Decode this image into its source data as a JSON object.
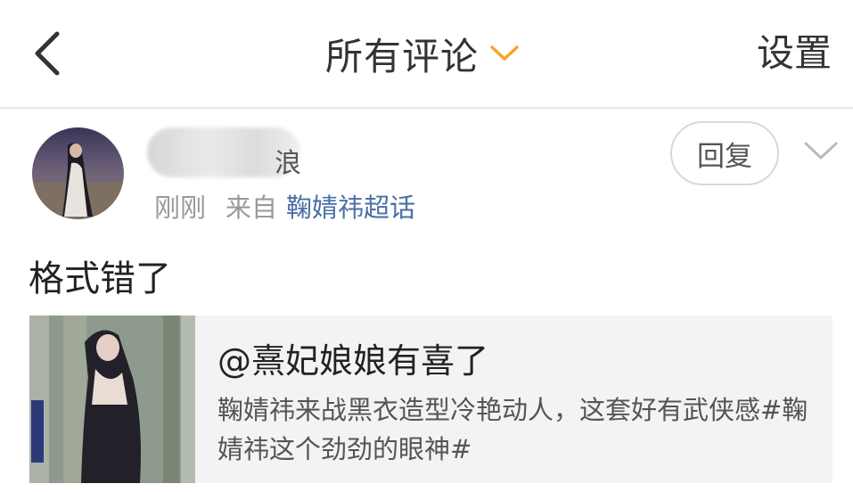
{
  "header": {
    "title": "所有评论",
    "settings_label": "设置",
    "back_icon": "chevron-left-icon",
    "title_arrow_icon": "chevron-down-icon",
    "accent_color": "#f5a623"
  },
  "comment": {
    "username_partial": "浪",
    "time": "刚刚",
    "from_label": "来自",
    "source": "鞠婧祎超话",
    "reply_label": "回复",
    "text": "格式错了"
  },
  "card": {
    "title": "@熹妃娘娘有喜了",
    "description": "鞠婧祎来战黑衣造型冷艳动人，这套好有武侠感#鞠婧祎这个劲劲的眼神#"
  },
  "colors": {
    "link": "#4b6fa4",
    "muted": "#999999",
    "card_bg": "#f3f3f3"
  }
}
